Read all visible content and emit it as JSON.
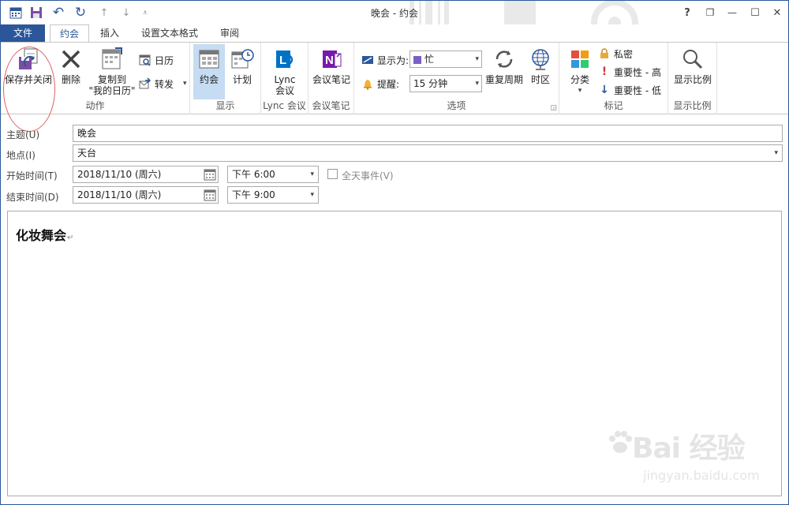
{
  "window": {
    "title": "晚会 - 约会",
    "help": "?",
    "restore": "❐",
    "minimize": "—",
    "maximize": "☐",
    "close": "✕"
  },
  "quick_access": {
    "undo": "↶",
    "redo": "↻",
    "up": "↑",
    "down": "↓",
    "customize": "⩡"
  },
  "tabs": {
    "file": "文件",
    "appointment": "约会",
    "insert": "插入",
    "format_text": "设置文本格式",
    "review": "审阅"
  },
  "ribbon": {
    "actions": {
      "label": "动作",
      "save_close": "保存并关闭",
      "delete": "删除",
      "copy_to_my_calendar_line1": "复制到",
      "copy_to_my_calendar_line2": "\"我的日历\"",
      "calendar": "日历",
      "forward": "转发"
    },
    "show": {
      "label": "显示",
      "appointment": "约会",
      "scheduling": "计划"
    },
    "lync": {
      "label": "Lync 会议",
      "lync_meeting_line1": "Lync",
      "lync_meeting_line2": "会议"
    },
    "meeting_notes": {
      "label": "会议笔记",
      "meeting_notes": "会议笔记"
    },
    "options": {
      "label": "选项",
      "show_as_label": "显示为:",
      "show_as_value": "忙",
      "reminder_label": "提醒:",
      "reminder_value": "15 分钟",
      "recurrence": "重复周期",
      "time_zones": "时区"
    },
    "tags": {
      "label": "标记",
      "categorize": "分类",
      "private": "私密",
      "high_importance": "重要性 - 高",
      "low_importance": "重要性 - 低"
    },
    "zoom": {
      "label": "显示比例",
      "zoom": "显示比例"
    }
  },
  "form": {
    "subject_label": "主题(U)",
    "subject_value": "晚会",
    "location_label": "地点(I)",
    "location_value": "天台",
    "start_label": "开始时间(T)",
    "start_date": "2018/11/10 (周六)",
    "start_time": "下午 6:00",
    "all_day_label": "全天事件(V)",
    "end_label": "结束时间(D)",
    "end_date": "2018/11/10 (周六)",
    "end_time": "下午 9:00"
  },
  "body": {
    "text": "化妆舞会",
    "paragraph_mark": "↵"
  },
  "watermark": {
    "brand": "Bai 经验",
    "url": "jingyan.baidu.com"
  },
  "colors": {
    "accent": "#2b579a",
    "show_as_busy": "#7b5fc8",
    "annotation": "#e06060",
    "high_importance": "#d13438",
    "low_importance": "#2b579a"
  }
}
